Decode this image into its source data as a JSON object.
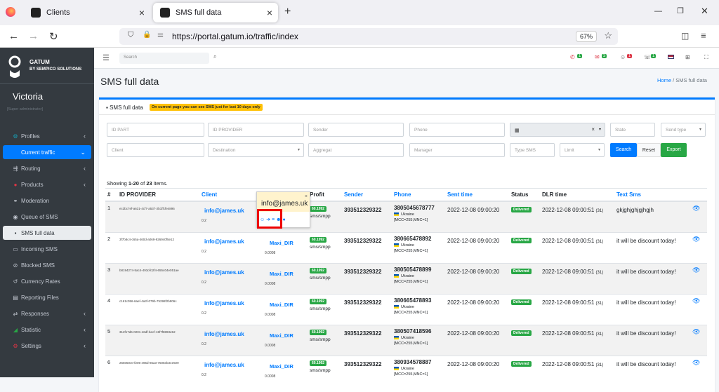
{
  "browser": {
    "tabs": [
      {
        "label": "Clients"
      },
      {
        "label": "SMS full data"
      }
    ],
    "url": "https://portal.gatum.io/traffic/index",
    "zoom": "67%"
  },
  "sidebar": {
    "brand": "GATUM",
    "brand_sub": "BY SEMPICO SOLUTIONS",
    "user": "Victoria",
    "role": "[Super administrator]",
    "items": [
      {
        "label": "Profiles",
        "icon": "users-icon"
      },
      {
        "label": "Current traffic",
        "icon": "traffic-icon"
      },
      {
        "label": "Routing",
        "icon": "routing-icon"
      },
      {
        "label": "Products",
        "icon": "product-icon"
      },
      {
        "label": "Moderation",
        "icon": "moderation-icon"
      },
      {
        "label": "Queue of SMS",
        "icon": "queue-icon"
      },
      {
        "label": "SMS full data",
        "icon": "sms-icon"
      },
      {
        "label": "Incoming SMS",
        "icon": "incoming-icon"
      },
      {
        "label": "Blocked SMS",
        "icon": "blocked-icon"
      },
      {
        "label": "Currency Rates",
        "icon": "currency-icon"
      },
      {
        "label": "Reporting Files",
        "icon": "file-icon"
      },
      {
        "label": "Responses",
        "icon": "response-icon"
      },
      {
        "label": "Statistic",
        "icon": "chart-icon"
      },
      {
        "label": "Settings",
        "icon": "settings-icon"
      }
    ]
  },
  "topnav": {
    "search_placeholder": "Search",
    "badges": [
      "1",
      "3",
      "1",
      "1"
    ]
  },
  "page": {
    "title": "SMS full data",
    "crumb_home": "Home",
    "crumb_sep": "/",
    "crumb_current": "SMS full data"
  },
  "card": {
    "title": "SMS full data",
    "notice": "On current page you can see SMS just for last 10 days only"
  },
  "filters": {
    "id_part": "ID PART",
    "id_provider": "ID PROVIDER",
    "sender": "Sender",
    "phone": "Phone",
    "state": "State",
    "send_type": "Send type",
    "client": "Client",
    "destination": "Destination",
    "aggregat": "Aggregat",
    "manager": "Manager",
    "type_sms": "Type SMS",
    "limit": "Limit",
    "search_btn": "Search",
    "reset_btn": "Reset",
    "export_btn": "Export"
  },
  "summary": {
    "pre": "Showing ",
    "range": "1-20",
    "mid": " of ",
    "total": "23",
    "post": " items."
  },
  "table": {
    "headers": [
      "#",
      "ID PROVIDER",
      "Client",
      "",
      "Profit",
      "Sender",
      "Phone",
      "Sent time",
      "Status",
      "DLR time",
      "Text Sms",
      ""
    ],
    "rows": [
      {
        "n": "1",
        "idp": "ec3bc7ef-a631-4cf7-a537-2b1ffcfe4895",
        "client": "info@james.uk",
        "client_small": "0.2",
        "provider": "",
        "prov_small": "",
        "profit": "60.1992",
        "type": "sms/smpp",
        "sender": "393512329322",
        "phone": "3805045678777",
        "country": "Ukraine",
        "mcc": "[MCC=255,MNC=1]",
        "sent": "2022-12-08 09:00:20",
        "status": "Delivered",
        "dlr": "2022-12-08 09:00:51",
        "dlr_sec": "(31)",
        "text": "gkjghjghjgjhgjh"
      },
      {
        "n": "2",
        "idp": "3f7b8c4-c65a-460d-a069-926940f5e12",
        "client": "info@james.uk",
        "client_small": "0.2",
        "provider": "Maxi_DIR",
        "prov_small": "0.0008",
        "profit": "60.1992",
        "type": "sms/smpp",
        "sender": "393512329322",
        "phone": "380665478892",
        "country": "Ukraine",
        "mcc": "[MCC=255,MNC=1]",
        "sent": "2022-12-08 09:00:20",
        "status": "Delivered",
        "dlr": "2022-12-08 09:00:51",
        "dlr_sec": "(31)",
        "text": "it will be discount today!"
      },
      {
        "n": "3",
        "idp": "b8194274-5ac4-493d-b2f4-655404e051ae",
        "client": "info@james.uk",
        "client_small": "0.2",
        "provider": "Maxi_DIR",
        "prov_small": "0.0008",
        "profit": "60.1992",
        "type": "sms/smpp",
        "sender": "393512329322",
        "phone": "380505478899",
        "country": "Ukraine",
        "mcc": "[MCC=255,MNC=1]",
        "sent": "2022-12-08 09:00:20",
        "status": "Delivered",
        "dlr": "2022-12-08 09:00:51",
        "dlr_sec": "(31)",
        "text": "it will be discount today!"
      },
      {
        "n": "4",
        "idp": "c161c056-6aef-4a3f-079b-75298f2b906c",
        "client": "info@james.uk",
        "client_small": "0.2",
        "provider": "Maxi_DIR",
        "prov_small": "0.0008",
        "profit": "60.1992",
        "type": "sms/smpp",
        "sender": "393512329322",
        "phone": "380665478893",
        "country": "Ukraine",
        "mcc": "[MCC=255,MNC=1]",
        "sent": "2022-12-08 09:00:20",
        "status": "Delivered",
        "dlr": "2022-12-08 09:00:51",
        "dlr_sec": "(31)",
        "text": "it will be discount today!"
      },
      {
        "n": "5",
        "idp": "312f17d6-0201-46df-becf-15f7f8893e52",
        "client": "info@james.uk",
        "client_small": "0.2",
        "provider": "Maxi_DIR",
        "prov_small": "0.0008",
        "profit": "60.1992",
        "type": "sms/smpp",
        "sender": "393512329322",
        "phone": "380507418596",
        "country": "Ukraine",
        "mcc": "[MCC=255,MNC=1]",
        "sent": "2022-12-08 09:00:20",
        "status": "Delivered",
        "dlr": "2022-12-08 09:00:51",
        "dlr_sec": "(31)",
        "text": "it will be discount today!"
      },
      {
        "n": "6",
        "idp": "265050c0-f205-495d-85a3-7505eb34e929",
        "client": "info@james.uk",
        "client_small": "0.2",
        "provider": "Maxi_DIR",
        "prov_small": "0.0008",
        "profit": "60.1992",
        "type": "sms/smpp",
        "sender": "393512329322",
        "phone": "380934578887",
        "country": "Ukraine",
        "mcc": "[MCC=255,MNC=1]",
        "sent": "2022-12-08 09:00:20",
        "status": "Delivered",
        "dlr": "2022-12-08 09:00:51",
        "dlr_sec": "(31)",
        "text": "it will be discount today!"
      }
    ]
  },
  "popover": {
    "text": "info@james.uk",
    "close": "×"
  }
}
